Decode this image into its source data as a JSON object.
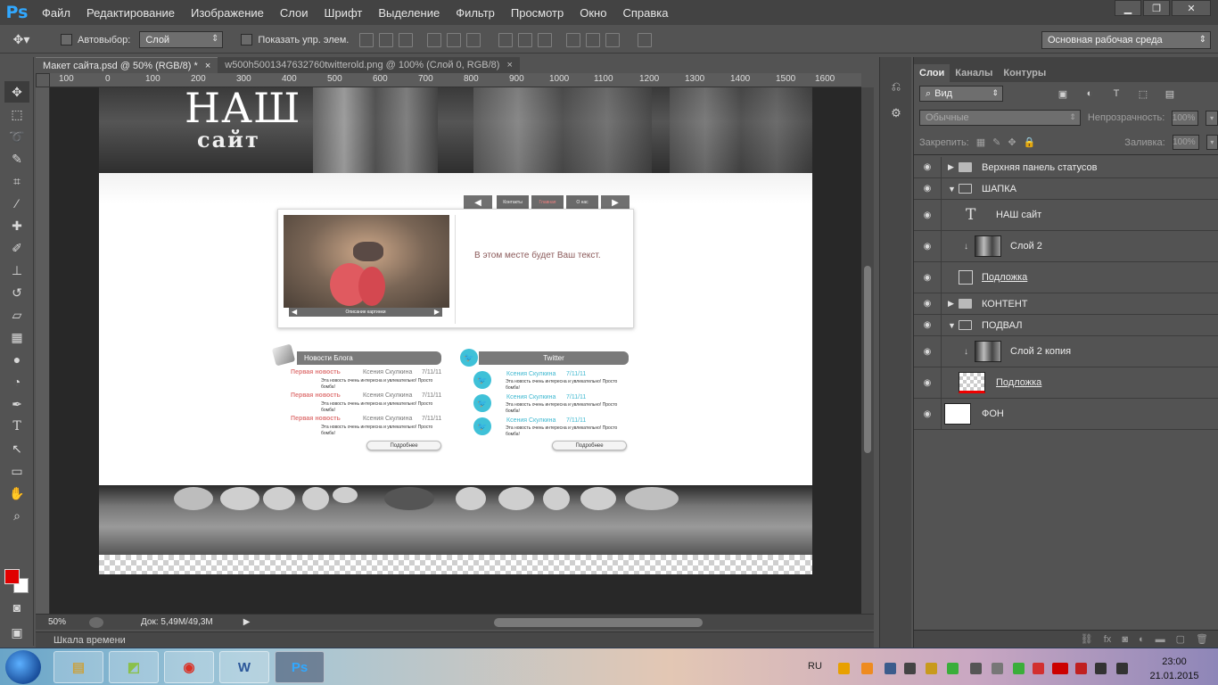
{
  "app": {
    "logo": "Ps"
  },
  "menu": [
    "Файл",
    "Редактирование",
    "Изображение",
    "Слои",
    "Шрифт",
    "Выделение",
    "Фильтр",
    "Просмотр",
    "Окно",
    "Справка"
  ],
  "window_controls": {
    "minimize": "▁",
    "maximize": "❐",
    "close": "✕"
  },
  "options": {
    "autoselect_label": "Автовыбор:",
    "autoselect_value": "Слой",
    "show_controls_label": "Показать упр. элем.",
    "workspace": "Основная рабочая среда"
  },
  "tabs": [
    {
      "label": "Макет сайта.psd @ 50% (RGB/8) *",
      "close": "×"
    },
    {
      "label": "w500h5001347632760twitterold.png @ 100% (Слой 0, RGB/8)",
      "close": "×"
    }
  ],
  "ruler": {
    "h_labels": [
      "100",
      "0",
      "100",
      "200",
      "300",
      "400",
      "500",
      "600",
      "700",
      "800",
      "900",
      "1000",
      "1100",
      "1200",
      "1300",
      "1400",
      "1500",
      "1600"
    ]
  },
  "doc": {
    "logo_title": "НАШ",
    "logo_sub": "сайт",
    "nav": {
      "prev": "◀",
      "items": [
        "Контакты",
        "Главная",
        "О нас"
      ],
      "next": "▶"
    },
    "slider_caption": "Описание картинки",
    "slider_text": "В этом месте будет Ваш текст.",
    "blog_heading": "Новости Блога",
    "twitter_heading": "Twitter",
    "news": [
      {
        "title": "Первая новость",
        "author": "Ксения Скулкина",
        "date": "7/11/11",
        "text": "Эта новость очень интересна и увлекательно! Просто бомба!"
      },
      {
        "title": "Первая новость",
        "author": "Ксения Скулкина",
        "date": "7/11/11",
        "text": "Эта новость очень интересна и увлекательно! Просто бомба!"
      },
      {
        "title": "Первая новость",
        "author": "Ксения Скулкина",
        "date": "7/11/11",
        "text": "Эта новость очень интересна и увлекательно! Просто бомба!"
      }
    ],
    "tweets": [
      {
        "author": "Ксения Скулкина",
        "date": "7/11/11",
        "text": "Эта новость очень интересна и увлекательно! Просто бомба!"
      },
      {
        "author": "Ксения Скулкина",
        "date": "7/11/11",
        "text": "Эта новость очень интересна и увлекательно! Просто бомба!"
      },
      {
        "author": "Ксения Скулкина",
        "date": "7/11/11",
        "text": "Эта новость очень интересна и увлекательно! Просто бомба!"
      }
    ],
    "more_label": "Подробнее"
  },
  "status": {
    "zoom": "50%",
    "doc_info": "Док: 5,49M/49,3M"
  },
  "timeline_label": "Шкала времени",
  "layers_panel": {
    "tabs": [
      "Слои",
      "Каналы",
      "Контуры"
    ],
    "kind": "Вид",
    "blend": "Обычные",
    "opacity_label": "Непрозрачность:",
    "opacity_value": "100%",
    "lock_label": "Закрепить:",
    "fill_label": "Заливка:",
    "fill_value": "100%",
    "layers": [
      {
        "name": "Верхняя панель статусов",
        "kind": "group-closed"
      },
      {
        "name": "ШАПКА",
        "kind": "group-open"
      },
      {
        "name": "НАШ сайт",
        "kind": "text"
      },
      {
        "name": "Слой 2",
        "kind": "clipped-photo"
      },
      {
        "name": "Подложка",
        "kind": "shape"
      },
      {
        "name": "КОНТЕНТ",
        "kind": "group-closed"
      },
      {
        "name": "ПОДВАЛ",
        "kind": "group-open"
      },
      {
        "name": "Слой 2 копия",
        "kind": "clipped-photo"
      },
      {
        "name": "Подложка",
        "kind": "transparent"
      },
      {
        "name": "ФОН",
        "kind": "white"
      }
    ]
  },
  "taskbar": {
    "lang": "RU",
    "time": "23:00",
    "date": "21.01.2015",
    "word_label": "W",
    "ps_label": "Ps"
  }
}
